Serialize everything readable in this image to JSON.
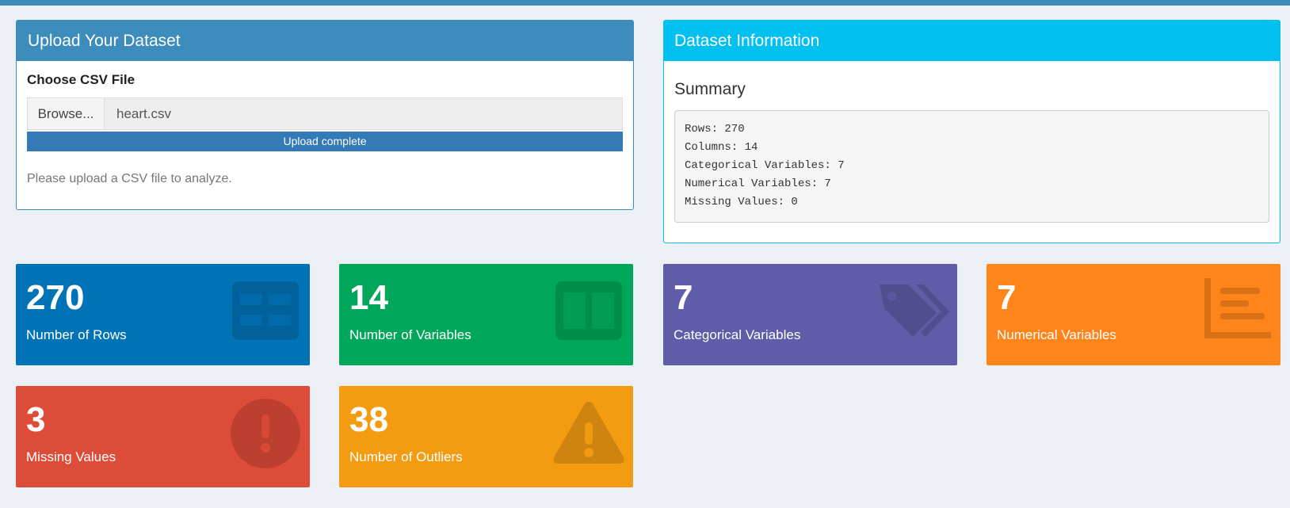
{
  "upload": {
    "title": "Upload Your Dataset",
    "file_label": "Choose CSV File",
    "browse_label": "Browse...",
    "file_name": "heart.csv",
    "progress_text": "Upload complete",
    "progress_fraction": 1.0,
    "help_text": "Please upload a CSV file to analyze."
  },
  "info": {
    "title": "Dataset Information",
    "summary_title": "Summary",
    "summary_lines": [
      "Rows: 270",
      "Columns: 14",
      "Categorical Variables: 7",
      "Numerical Variables: 7",
      "Missing Values: 0"
    ]
  },
  "value_boxes": [
    {
      "value": "270",
      "label": "Number of Rows",
      "color": "#0073b7",
      "icon": "table-icon"
    },
    {
      "value": "14",
      "label": "Number of Variables",
      "color": "#00a65a",
      "icon": "columns-icon"
    },
    {
      "value": "7",
      "label": "Categorical Variables",
      "color": "#605ca8",
      "icon": "tags-icon"
    },
    {
      "value": "7",
      "label": "Numerical Variables",
      "color": "#ff851b",
      "icon": "chart-bar-icon"
    },
    {
      "value": "3",
      "label": "Missing Values",
      "color": "#dd4b39",
      "icon": "exclamation-circle-icon"
    },
    {
      "value": "38",
      "label": "Number of Outliers",
      "color": "#f39c12",
      "icon": "warning-icon"
    }
  ],
  "colors": {
    "primary": "#3c8dbc",
    "info": "#00c0ef",
    "progress": "#337ab7",
    "background": "#ecf0f5"
  }
}
